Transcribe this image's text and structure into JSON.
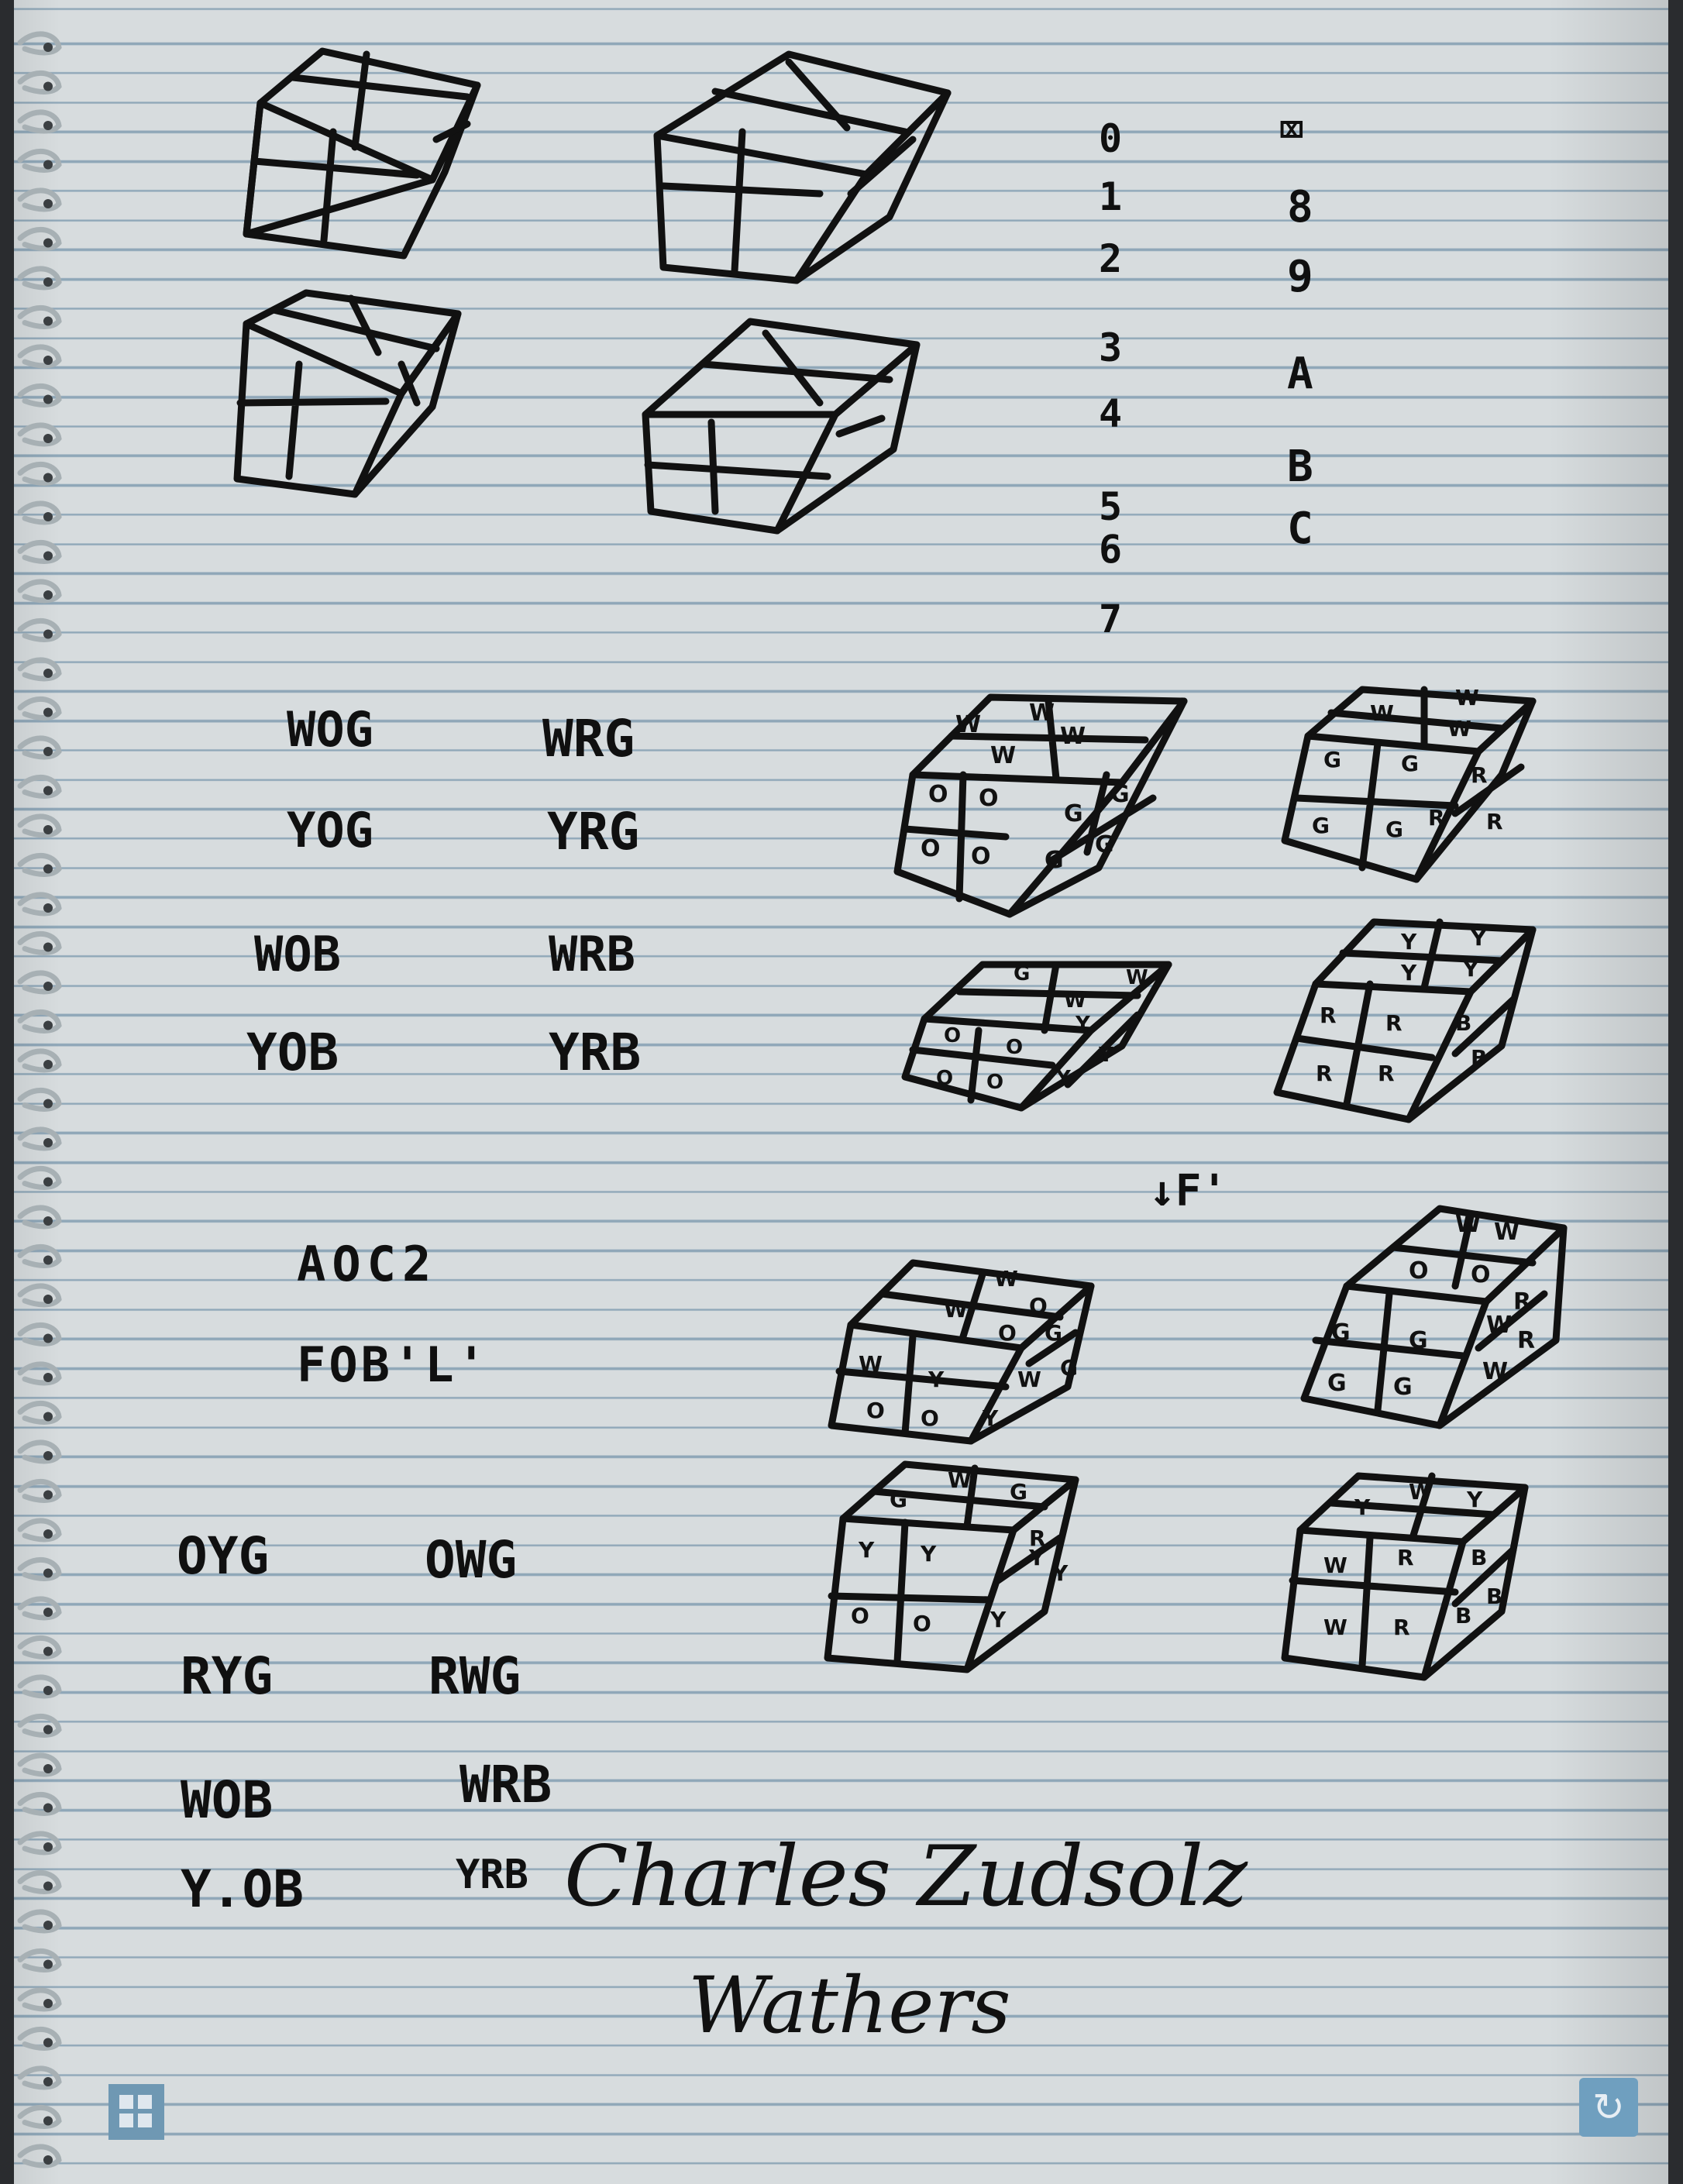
{
  "notes": {
    "number_column": [
      "0",
      "1",
      "2",
      "3",
      "4",
      "5",
      "6",
      "7"
    ],
    "symbol_column": [
      "8",
      "9",
      "A",
      "B",
      "C"
    ],
    "corner_sets_1": {
      "left": [
        "WOG",
        "YOG",
        "WOB",
        "YOB"
      ],
      "right": [
        "WRG",
        "YRG",
        "WRB",
        "YRB"
      ]
    },
    "algorithm": [
      "AOC2",
      "FOB'L'"
    ],
    "arrow_note": "F'",
    "corner_sets_2": {
      "left": [
        "OYG",
        "RYG",
        "WOB",
        "Y.OB"
      ],
      "right": [
        "OWG",
        "RWG",
        "WRB",
        "YRB"
      ]
    },
    "signature": [
      "Charles Zudsolz",
      "Wathers"
    ]
  },
  "cube_labels": {
    "c1": [
      "W",
      "W",
      "W",
      "W",
      "O",
      "O",
      "O",
      "O",
      "G",
      "G",
      "G",
      "G"
    ],
    "c2": [
      "W",
      "W",
      "W",
      "G",
      "G",
      "G",
      "G",
      "R",
      "R",
      "R"
    ],
    "c3": [
      "G",
      "W",
      "W",
      "O",
      "O",
      "O",
      "O",
      "Y",
      "Y",
      "Y"
    ],
    "c4": [
      "Y",
      "Y",
      "Y",
      "Y",
      "R",
      "R",
      "R",
      "R",
      "B",
      "B"
    ],
    "c5": [
      "W",
      "O",
      "W",
      "O",
      "W",
      "O",
      "Y",
      "O",
      "Y",
      "G",
      "G",
      "W"
    ],
    "c6": [
      "W",
      "W",
      "O",
      "O",
      "G",
      "G",
      "G",
      "G",
      "W",
      "R",
      "W",
      "R"
    ],
    "c7": [
      "G",
      "W",
      "G",
      "Y",
      "Y",
      "Y",
      "O",
      "O",
      "R",
      "Y",
      "Y"
    ],
    "c8": [
      "Y",
      "W",
      "Y",
      "W",
      "R",
      "W",
      "R",
      "B",
      "B",
      "B"
    ]
  }
}
